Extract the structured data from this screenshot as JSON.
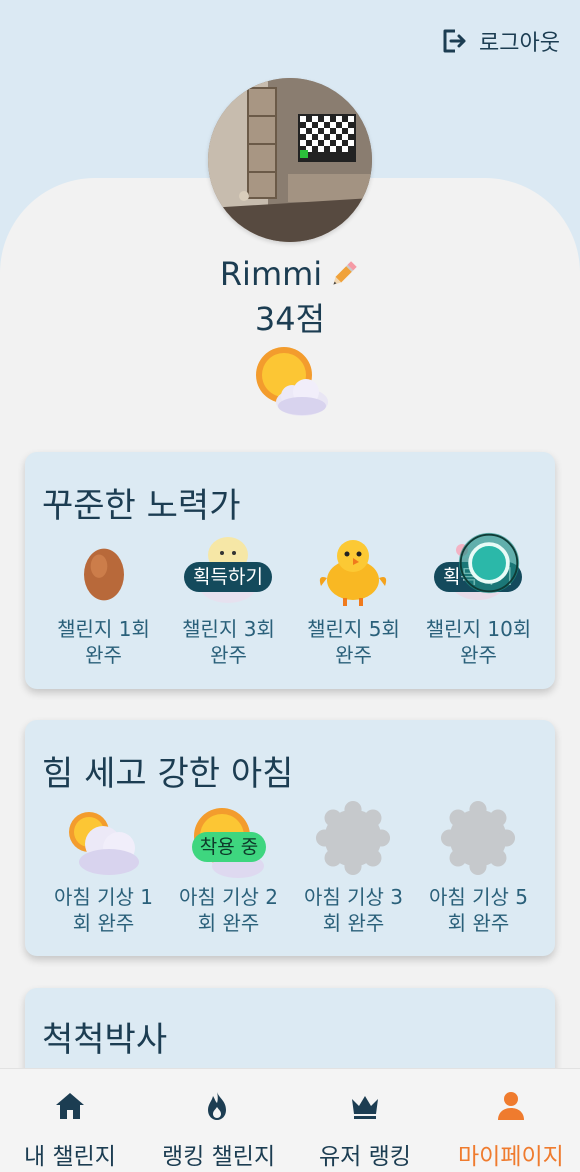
{
  "header": {
    "logout_label": "로그아웃"
  },
  "profile": {
    "nickname": "Rimmi",
    "score": "34점"
  },
  "sections": [
    {
      "title": "꾸준한 노력가",
      "badges": [
        {
          "line1": "챌린지 1회",
          "line2": "완주",
          "state": "earned"
        },
        {
          "line1": "챌린지 3회",
          "line2": "완주",
          "state": "claimable",
          "action": "획득하기"
        },
        {
          "line1": "챌린지 5회",
          "line2": "완주",
          "state": "earned"
        },
        {
          "line1": "챌린지 10회",
          "line2": "완주",
          "state": "claimable",
          "action": "획득하기"
        }
      ]
    },
    {
      "title": "힘 세고 강한 아침",
      "badges": [
        {
          "line1": "아침 기상 1",
          "line2": "회 완주",
          "state": "earned"
        },
        {
          "line1": "아침 기상 2",
          "line2": "회 완주",
          "state": "equipped",
          "action": "착용 중"
        },
        {
          "line1": "아침 기상 3",
          "line2": "회 완주",
          "state": "locked"
        },
        {
          "line1": "아침 기상 5",
          "line2": "회 완주",
          "state": "locked"
        }
      ]
    },
    {
      "title": "척척박사"
    }
  ],
  "nav": [
    {
      "label": "내 챌린지",
      "icon": "home-icon",
      "active": false
    },
    {
      "label": "랭킹 챌린지",
      "icon": "flame-icon",
      "active": false
    },
    {
      "label": "유저 랭킹",
      "icon": "crown-icon",
      "active": false
    },
    {
      "label": "마이페이지",
      "icon": "person-icon",
      "active": true
    }
  ],
  "colors": {
    "primary": "#1c3d52",
    "accent": "#ef7b2e",
    "pill_dark": "#144a5c",
    "pill_green": "#3ed67f",
    "card_bg": "#dceaf3"
  }
}
